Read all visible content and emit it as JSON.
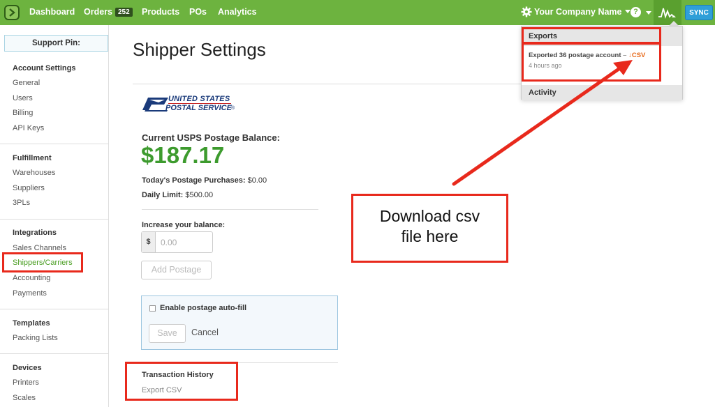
{
  "topnav": {
    "items": [
      {
        "label": "Dashboard"
      },
      {
        "label": "Orders",
        "badge": "252"
      },
      {
        "label": "Products"
      },
      {
        "label": "POs"
      },
      {
        "label": "Analytics"
      }
    ],
    "company": "Your Company Name",
    "help": "?",
    "sync": "SYNC",
    "colors": {
      "bar": "#6db33f",
      "sync": "#2f9fd8"
    }
  },
  "sidebar": {
    "support_pin": "Support Pin:",
    "sections": [
      {
        "heading": "Account Settings",
        "items": [
          "General",
          "Users",
          "Billing",
          "API Keys"
        ]
      },
      {
        "heading": "Fulfillment",
        "items": [
          "Warehouses",
          "Suppliers",
          "3PLs"
        ]
      },
      {
        "heading": "Integrations",
        "items": [
          "Sales Channels",
          "Shippers/Carriers",
          "Accounting",
          "Payments"
        ]
      },
      {
        "heading": "Templates",
        "items": [
          "Packing Lists"
        ]
      },
      {
        "heading": "Devices",
        "items": [
          "Printers",
          "Scales"
        ]
      }
    ],
    "active_item": "Shippers/Carriers"
  },
  "main": {
    "title": "Shipper Settings",
    "usps_line1": "UNITED STATES",
    "usps_line2": "POSTAL SERVICE",
    "usps_reg": "®",
    "balance_heading": "Current USPS Postage Balance:",
    "balance": "$187.17",
    "todays_label": "Today's Postage Purchases:",
    "todays_value": "$0.00",
    "limit_label": "Daily Limit:",
    "limit_value": "$500.00",
    "increase_heading": "Increase your balance:",
    "currency": "$",
    "amount_placeholder": "0.00",
    "add_postage": "Add Postage",
    "autofill_label": "Enable postage auto-fill",
    "save": "Save",
    "cancel": "Cancel",
    "transaction_heading": "Transaction History",
    "export_csv": "Export CSV"
  },
  "dropdown": {
    "exports_heading": "Exports",
    "export_text": "Exported 36 postage account",
    "dash": "–",
    "csv_arrow": "↓",
    "csv": "CSV",
    "time": "4 hours ago",
    "activity_heading": "Activity"
  },
  "annotation": {
    "line1": "Download csv",
    "line2": "file here",
    "color": "#e8291c"
  }
}
